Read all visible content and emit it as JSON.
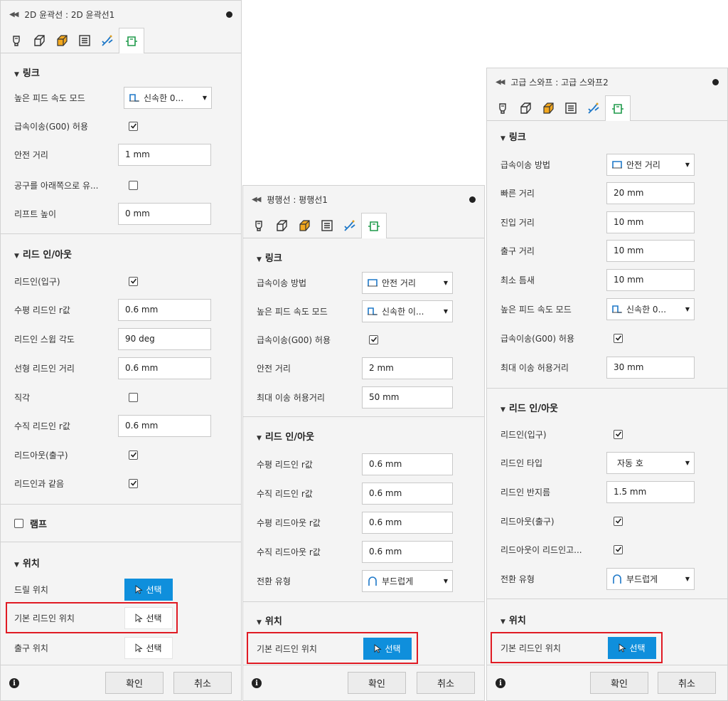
{
  "panel1": {
    "title": "2D 윤곽선 : 2D 윤곽선1",
    "sec_link": "링크",
    "high_feed_label": "높은 피드 속도 모드",
    "high_feed_value": "신속한 0...",
    "rapid_allow_label": "급속이송(G00) 허용",
    "safe_dist_label": "안전 거리",
    "safe_dist_value": "1 mm",
    "tool_down_label": "공구를 아래쪽으로 유...",
    "lift_height_label": "리프트 높이",
    "lift_height_value": "0 mm",
    "sec_leadinout": "리드 인/아웃",
    "leadin_label": "리드인(입구)",
    "horiz_leadin_label": "수평 리드인 r값",
    "horiz_leadin_value": "0.6 mm",
    "leadin_sweep_label": "리드인 스윕 각도",
    "leadin_sweep_value": "90 deg",
    "linear_leadin_label": "선형 리드인 거리",
    "linear_leadin_value": "0.6 mm",
    "perp_label": "직각",
    "vert_leadin_label": "수직 리드인 r값",
    "vert_leadin_value": "0.6 mm",
    "leadout_label": "리드아웃(출구)",
    "same_as_leadin_label": "리드인과 같음",
    "sec_ramp": "램프",
    "sec_position": "위치",
    "drill_pos_label": "드릴 위치",
    "default_leadin_pos_label": "기본 리드인 위치",
    "exit_pos_label": "출구 위치",
    "select_label": "선택",
    "ok_label": "확인",
    "cancel_label": "취소"
  },
  "panel2": {
    "title": "평행선 : 평행선1",
    "sec_link": "링크",
    "rapid_method_label": "급속이송 방법",
    "rapid_method_value": "안전 거리",
    "high_feed_label": "높은 피드 속도 모드",
    "high_feed_value": "신속한 이...",
    "rapid_allow_label": "급속이송(G00) 허용",
    "safe_dist_label": "안전 거리",
    "safe_dist_value": "2 mm",
    "max_stay_label": "최대 이송 허용거리",
    "max_stay_value": "50 mm",
    "sec_leadinout": "리드 인/아웃",
    "horiz_leadin_label": "수평 리드인 r값",
    "horiz_leadin_value": "0.6 mm",
    "vert_leadin_label": "수직 리드인 r값",
    "vert_leadin_value": "0.6 mm",
    "horiz_leadout_label": "수평 리드아웃 r값",
    "horiz_leadout_value": "0.6 mm",
    "vert_leadout_label": "수직 리드아웃 r값",
    "vert_leadout_value": "0.6 mm",
    "transition_label": "전환 유형",
    "transition_value": "부드럽게",
    "sec_position": "위치",
    "default_leadin_pos_label": "기본 리드인 위치",
    "select_label": "선택",
    "ok_label": "확인",
    "cancel_label": "취소"
  },
  "panel3": {
    "title": "고급 스와프 : 고급 스와프2",
    "sec_link": "링크",
    "rapid_method_label": "급속이송 방법",
    "rapid_method_value": "안전 거리",
    "fast_dist_label": "빠른 거리",
    "fast_dist_value": "20 mm",
    "entry_dist_label": "진입 거리",
    "entry_dist_value": "10 mm",
    "exit_dist_label": "출구 거리",
    "exit_dist_value": "10 mm",
    "min_gap_label": "최소 틈새",
    "min_gap_value": "10 mm",
    "high_feed_label": "높은 피드 속도 모드",
    "high_feed_value": "신속한 0...",
    "rapid_allow_label": "급속이송(G00) 허용",
    "max_stay_label": "최대 이송 허용거리",
    "max_stay_value": "30 mm",
    "sec_leadinout": "리드 인/아웃",
    "leadin_label": "리드인(입구)",
    "leadin_type_label": "리드인 타입",
    "leadin_type_value": "자동 호",
    "leadin_radius_label": "리드인 반지름",
    "leadin_radius_value": "1.5 mm",
    "leadout_label": "리드아웃(출구)",
    "leadout_same_label": "리드아웃이 리드인고...",
    "transition_label": "전환 유형",
    "transition_value": "부드럽게",
    "sec_position": "위치",
    "default_leadin_pos_label": "기본 리드인 위치",
    "select_label": "선택",
    "ok_label": "확인",
    "cancel_label": "취소"
  },
  "colors": {
    "select_blue": "#0f8fdc",
    "highlight_red": "#e01b24",
    "panel_bg": "#f4f4f4"
  }
}
